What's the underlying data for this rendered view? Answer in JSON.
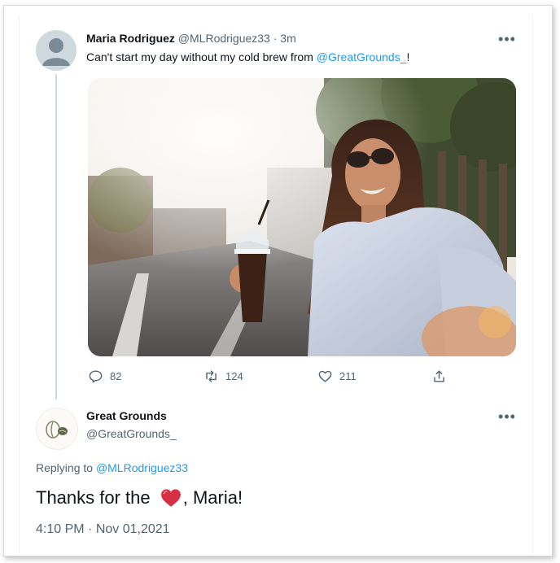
{
  "original_tweet": {
    "display_name": "Maria Rodriguez",
    "handle": "@MLRodriguez33",
    "separator": "·",
    "age": "3m",
    "text_before_mention": "Can't start my day without my cold brew from ",
    "mention": "@GreatGrounds_",
    "text_after_mention": "!",
    "stats": {
      "replies": "82",
      "retweets": "124",
      "likes": "211"
    }
  },
  "reply_tweet": {
    "display_name": "Great Grounds",
    "handle": "@GreatGrounds_",
    "replying_prefix": "Replying to ",
    "replying_to": "@MLRodriguez33",
    "text_before_emoji": "Thanks for the ",
    "emoji": "red-heart",
    "text_after_emoji": ", Maria!",
    "time": "4:10 PM",
    "separator": "·",
    "date": "Nov 01,2021"
  },
  "colors": {
    "link": "#1d9bf0",
    "muted_text": "#536471",
    "heart": "#e0304a"
  },
  "icons": [
    "more-options-icon",
    "reply-icon",
    "retweet-icon",
    "like-icon",
    "share-icon",
    "default-avatar-icon",
    "great-grounds-logo"
  ]
}
